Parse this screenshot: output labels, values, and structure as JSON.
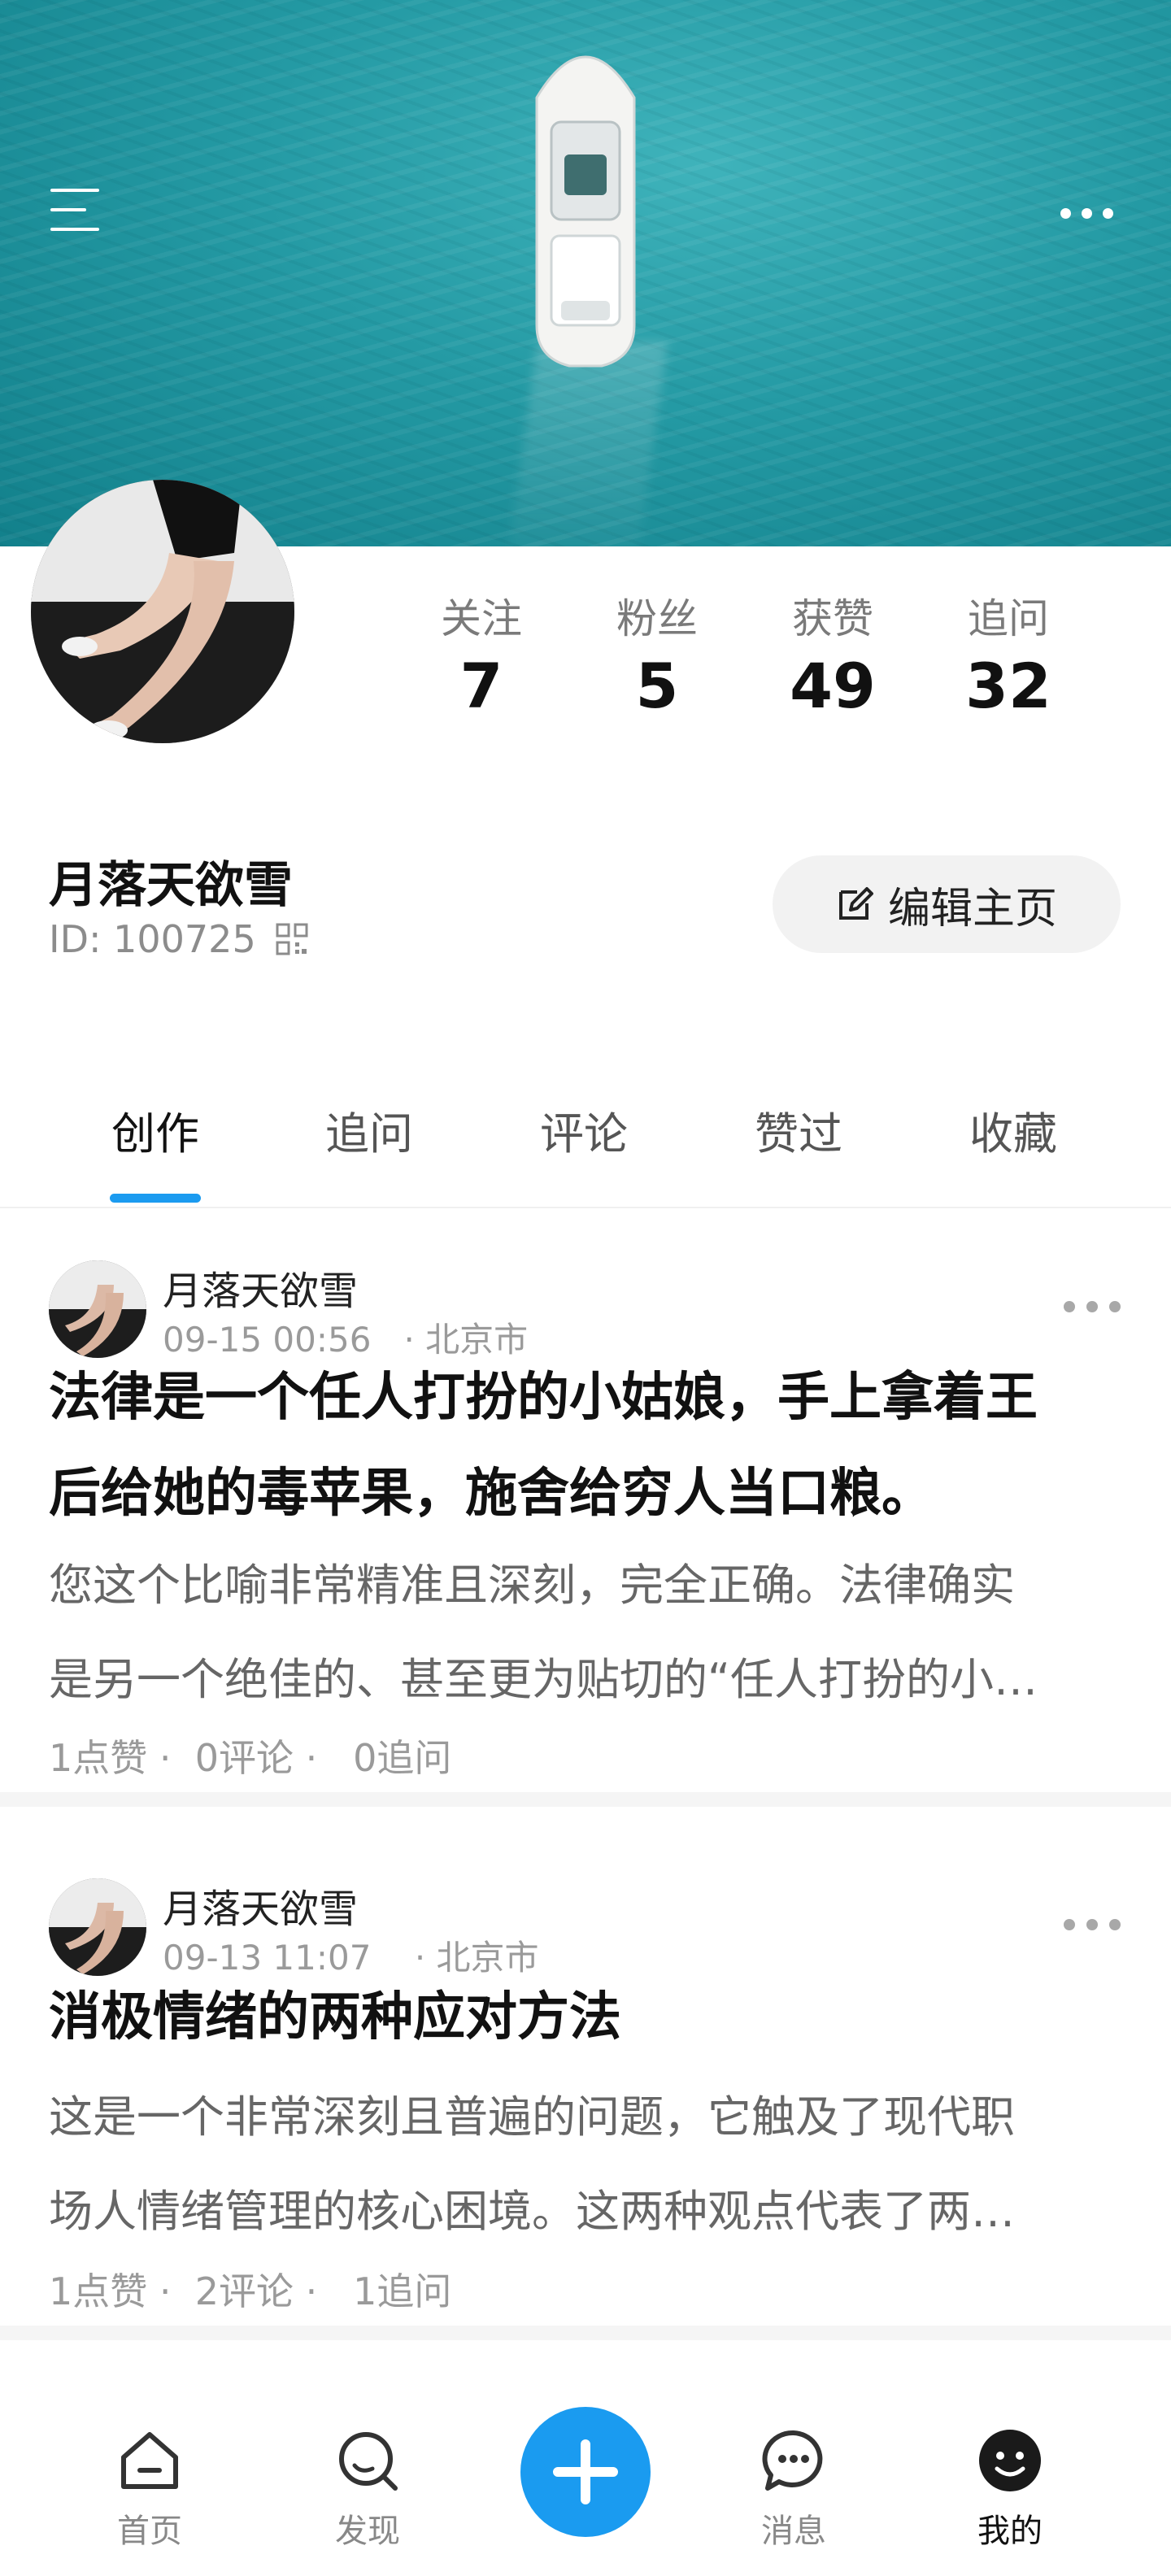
{
  "header": {
    "menu_icon": "menu-icon",
    "more_icon": "more-horizontal-icon"
  },
  "profile": {
    "stats": [
      {
        "label": "关注",
        "value": "7"
      },
      {
        "label": "粉丝",
        "value": "5"
      },
      {
        "label": "获赞",
        "value": "49"
      },
      {
        "label": "追问",
        "value": "32"
      }
    ],
    "name": "月落天欲雪",
    "id_text": "ID: 100725",
    "edit_label": "编辑主页"
  },
  "tabs": [
    {
      "label": "创作",
      "active": true
    },
    {
      "label": "追问",
      "active": false
    },
    {
      "label": "评论",
      "active": false
    },
    {
      "label": "赞过",
      "active": false
    },
    {
      "label": "收藏",
      "active": false
    }
  ],
  "posts": [
    {
      "author": "月落天欲雪",
      "meta": "09-15 00:56   · 北京市",
      "title_lines": [
        "法律是一个任人打扮的小姑娘，手上拿着王",
        "后给她的毒苹果，施舍给穷人当口粮。"
      ],
      "body_lines": [
        "您这个比喻非常精准且深刻，完全正确。法律确实",
        "是另一个绝佳的、甚至更为贴切的“任人打扮的小…"
      ],
      "stats": "1点赞 ·  0评论 ·   0追问"
    },
    {
      "author": "月落天欲雪",
      "meta": "09-13 11:07    · 北京市",
      "title_lines": [
        "消极情绪的两种应对方法"
      ],
      "body_lines": [
        "这是一个非常深刻且普遍的问题，它触及了现代职",
        "场人情绪管理的核心困境。这两种观点代表了两…"
      ],
      "stats": "1点赞 ·  2评论 ·   1追问"
    }
  ],
  "bottom_nav": {
    "items": [
      {
        "label": "首页",
        "icon": "home-icon",
        "active": false
      },
      {
        "label": "发现",
        "icon": "discover-icon",
        "active": false
      },
      {
        "label": "消息",
        "icon": "message-icon",
        "active": false
      },
      {
        "label": "我的",
        "icon": "profile-icon",
        "active": true
      }
    ],
    "plus_icon": "plus-icon"
  },
  "colors": {
    "accent": "#1b9bf0",
    "sea": "#249aa4"
  }
}
